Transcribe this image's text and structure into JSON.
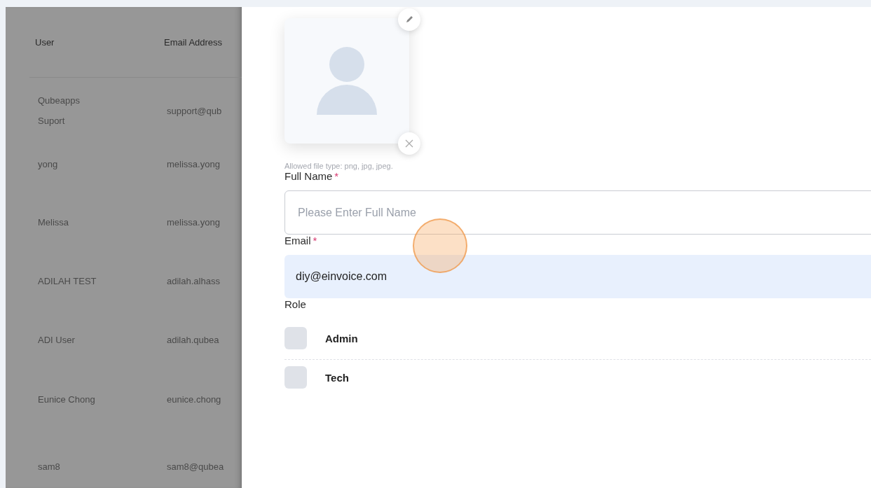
{
  "table": {
    "columns": [
      "User",
      "Email Address"
    ],
    "rows": [
      {
        "user": "Qubeapps Suport",
        "email": "support@qub"
      },
      {
        "user": "yong",
        "email": "melissa.yong"
      },
      {
        "user": "Melissa",
        "email": "melissa.yong"
      },
      {
        "user": "ADILAH TEST",
        "email": "adilah.alhass"
      },
      {
        "user": "ADI User",
        "email": "adilah.qubea"
      },
      {
        "user": "Eunice Chong",
        "email": "eunice.chong"
      },
      {
        "user": "sam8",
        "email": "sam8@qubea"
      }
    ]
  },
  "form": {
    "avatar_hint": "Allowed file type: png, jpg, jpeg.",
    "full_name": {
      "label": "Full Name",
      "required_mark": "*",
      "placeholder": "Please Enter Full Name"
    },
    "email": {
      "label": "Email",
      "required_mark": "*",
      "value": "diy@einvoice.com"
    },
    "role": {
      "label": "Role",
      "options": [
        {
          "label": "Admin",
          "checked": false
        },
        {
          "label": "Tech",
          "checked": false
        }
      ]
    }
  }
}
